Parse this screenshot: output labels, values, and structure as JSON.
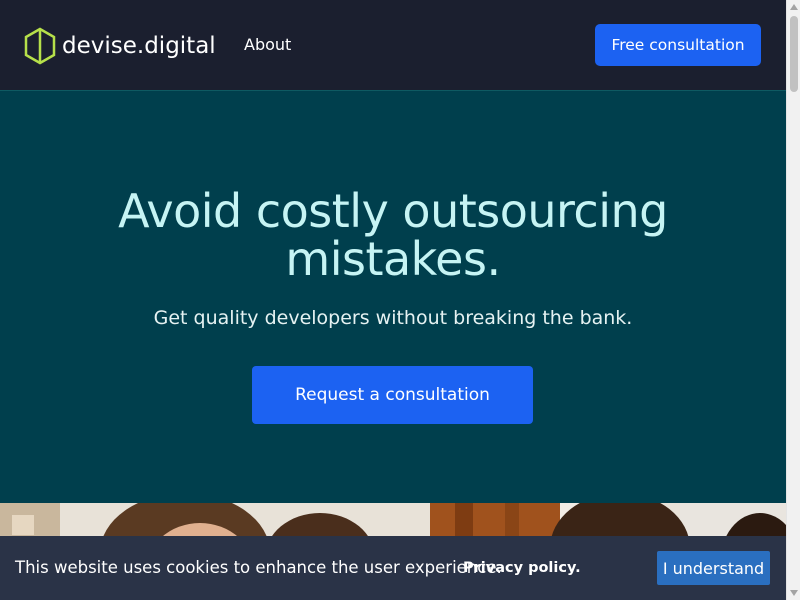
{
  "header": {
    "logo": {
      "word1": "devise",
      "dot": ".",
      "word2": "digital",
      "icon": "hexagon-logo-icon",
      "accent_color": "#b6e04a"
    },
    "nav": [
      {
        "label": "About"
      }
    ],
    "cta_label": "Free consultation"
  },
  "hero": {
    "title_line1": "Avoid costly outsourcing",
    "title_line2": "mistakes.",
    "subtitle": "Get quality developers without breaking the bank.",
    "cta_label": "Request a consultation",
    "background_color": "#003f4d"
  },
  "cookie_bar": {
    "message": "This website uses cookies to enhance the user experience.",
    "policy_link": "Privacy policy.",
    "accept_label": "I understand"
  },
  "colors": {
    "header_bg": "#1b1f2f",
    "primary_button": "#1c62f2",
    "hero_title": "#c6f4f4",
    "cookie_bg": "#2a3347",
    "cookie_button": "#2a6fc0"
  },
  "scrollbar": {
    "icons": [
      "scroll-up-arrow-icon",
      "scroll-down-arrow-icon"
    ]
  }
}
